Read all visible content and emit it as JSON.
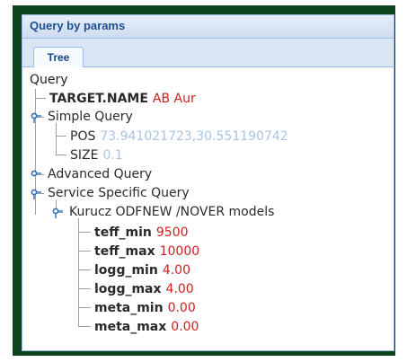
{
  "panel": {
    "title": "Query by params"
  },
  "tabs": [
    {
      "label": "Tree"
    }
  ],
  "tree": {
    "root": "Query",
    "target": {
      "key": "TARGET.NAME",
      "value": "AB Aur"
    },
    "simple": {
      "label": "Simple Query",
      "pos": {
        "key": "POS",
        "value": "73.941021723,30.551190742"
      },
      "size": {
        "key": "SIZE",
        "value": "0.1"
      }
    },
    "advanced": {
      "label": "Advanced Query"
    },
    "service": {
      "label": "Service Specific Query",
      "model": {
        "label": "Kurucz ODFNEW /NOVER models",
        "params": [
          {
            "key": "teff_min",
            "value": "9500"
          },
          {
            "key": "teff_max",
            "value": "10000"
          },
          {
            "key": "logg_min",
            "value": "4.00"
          },
          {
            "key": "logg_max",
            "value": "4.00"
          },
          {
            "key": "meta_min",
            "value": "0.00"
          },
          {
            "key": "meta_max",
            "value": "0.00"
          }
        ]
      }
    }
  },
  "colors": {
    "frame": "#0c4420",
    "panel_border": "#99bbe8",
    "header_text": "#1f4f92",
    "value_red": "#cc2020",
    "value_light": "#a8c4e6"
  }
}
